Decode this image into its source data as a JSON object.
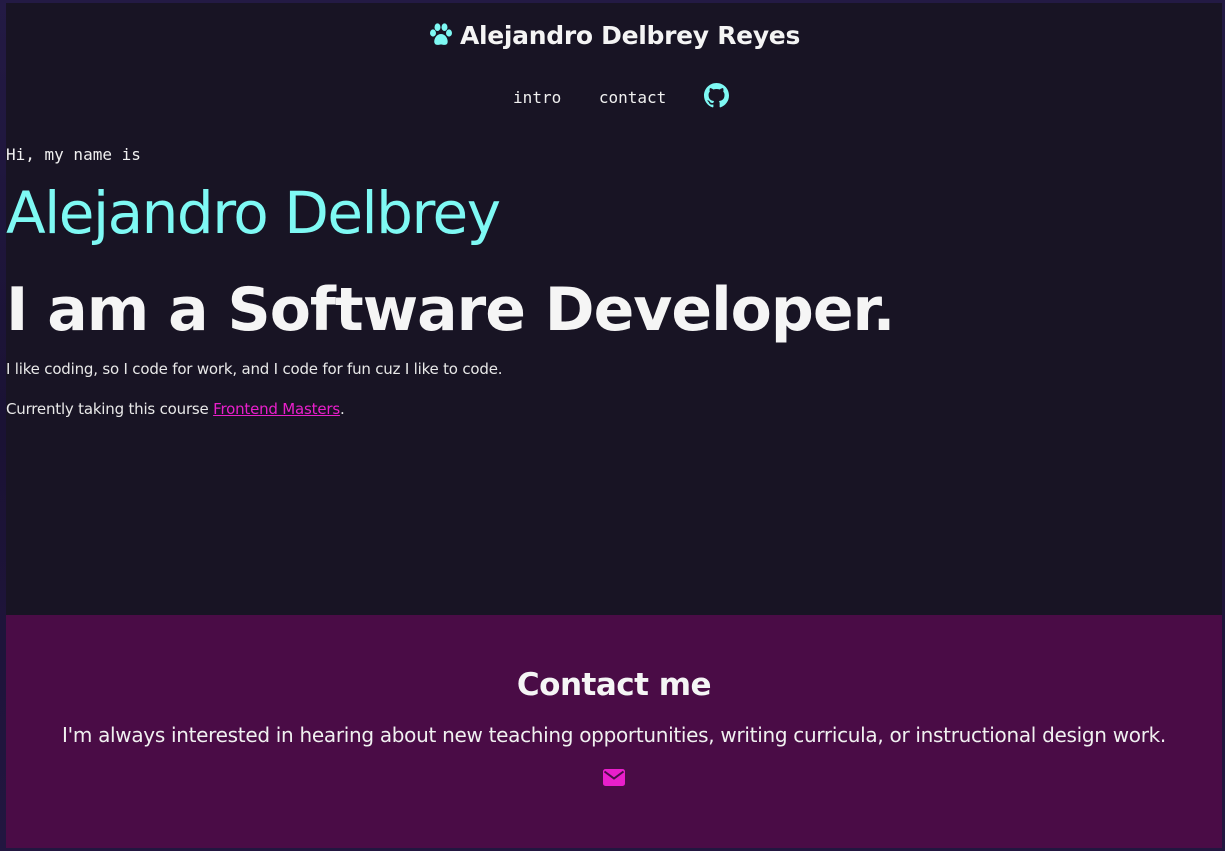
{
  "header": {
    "site_title": "Alejandro Delbrey Reyes",
    "logo_icon": "paw-icon"
  },
  "nav": {
    "items": [
      {
        "label": "intro"
      },
      {
        "label": "contact"
      }
    ],
    "github_icon": "github-icon"
  },
  "intro": {
    "greeting": "Hi, my name is",
    "name": "Alejandro Delbrey",
    "role": "I am a Software Developer.",
    "paragraph": "I like coding, so I code for work, and I code for fun cuz I like to code.",
    "course_prefix": "Currently taking this course ",
    "course_link": "Frontend Masters",
    "course_suffix": "."
  },
  "contact": {
    "heading": "Contact me",
    "text": "I'm always interested in hearing about new teaching opportunities, writing curricula, or instructional design work.",
    "mail_icon": "envelope-icon"
  },
  "colors": {
    "accent_cyan": "#7ef9f4",
    "accent_magenta": "#e91fcb",
    "background": "#181424",
    "contact_background": "#4a0c46"
  }
}
